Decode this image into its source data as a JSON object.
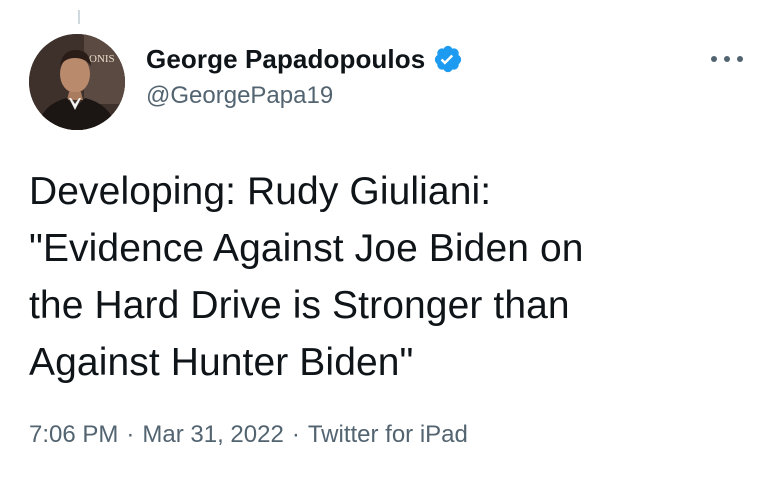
{
  "tweet": {
    "author": {
      "display_name": "George Papadopoulos",
      "handle": "@GeorgePapa19",
      "verified": true,
      "avatar_icon": "profile-photo",
      "avatar_backdrop_text": "ONIS"
    },
    "text_lines": [
      "Developing: Rudy Giuliani:",
      "\"Evidence Against Joe Biden on",
      "the Hard Drive is Stronger than",
      "Against Hunter Biden\""
    ],
    "time": "7:06 PM",
    "date": "Mar 31, 2022",
    "source": "Twitter for iPad",
    "separator": "·"
  },
  "icons": {
    "verified": "verified-badge-icon",
    "more": "more-options-icon"
  },
  "colors": {
    "verified_blue": "#1d9bf0",
    "secondary_text": "#536471",
    "primary_text": "#0f1419"
  }
}
